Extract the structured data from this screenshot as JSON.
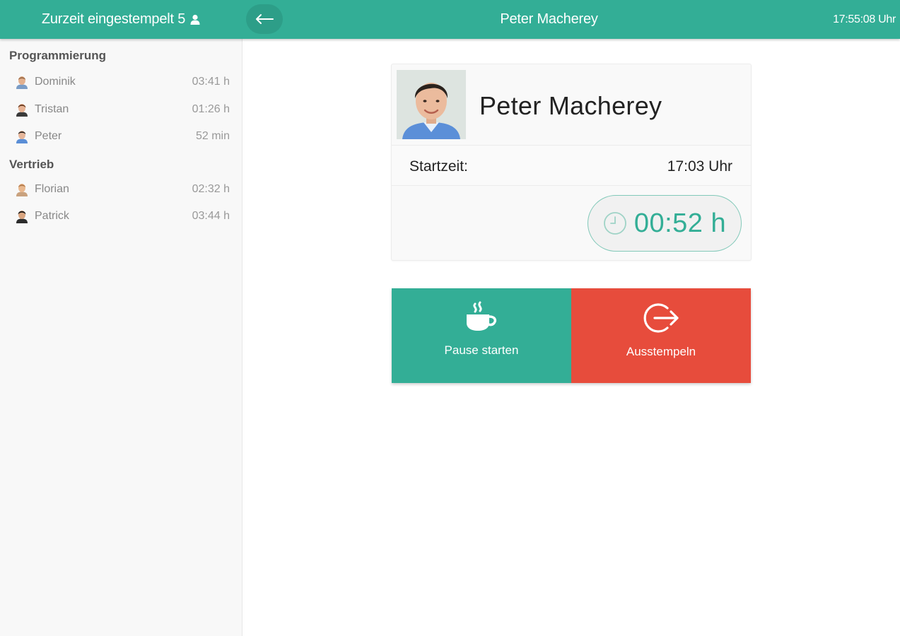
{
  "header": {
    "clocked_in_label": "Zurzeit eingestempelt 5",
    "title": "Peter Macherey",
    "time": "17:55:08 Uhr"
  },
  "sidebar": {
    "groups": [
      {
        "name": "Programmierung",
        "members": [
          {
            "name": "Dominik",
            "duration": "03:41 h"
          },
          {
            "name": "Tristan",
            "duration": "01:26 h"
          },
          {
            "name": "Peter",
            "duration": "52 min"
          }
        ]
      },
      {
        "name": "Vertrieb",
        "members": [
          {
            "name": "Florian",
            "duration": "02:32 h"
          },
          {
            "name": "Patrick",
            "duration": "03:44 h"
          }
        ]
      }
    ]
  },
  "employee": {
    "name": "Peter Macherey",
    "start_label": "Startzeit:",
    "start_value": "17:03 Uhr",
    "elapsed": "00:52 h"
  },
  "actions": {
    "pause_label": "Pause starten",
    "clock_out_label": "Ausstempeln"
  },
  "colors": {
    "primary": "#33ae96",
    "danger": "#e74c3c"
  },
  "icons": {
    "back": "arrow-left-icon",
    "user": "user-icon",
    "clock": "clock-icon",
    "pause": "coffee-cup-icon",
    "clock_out": "sign-out-icon"
  }
}
